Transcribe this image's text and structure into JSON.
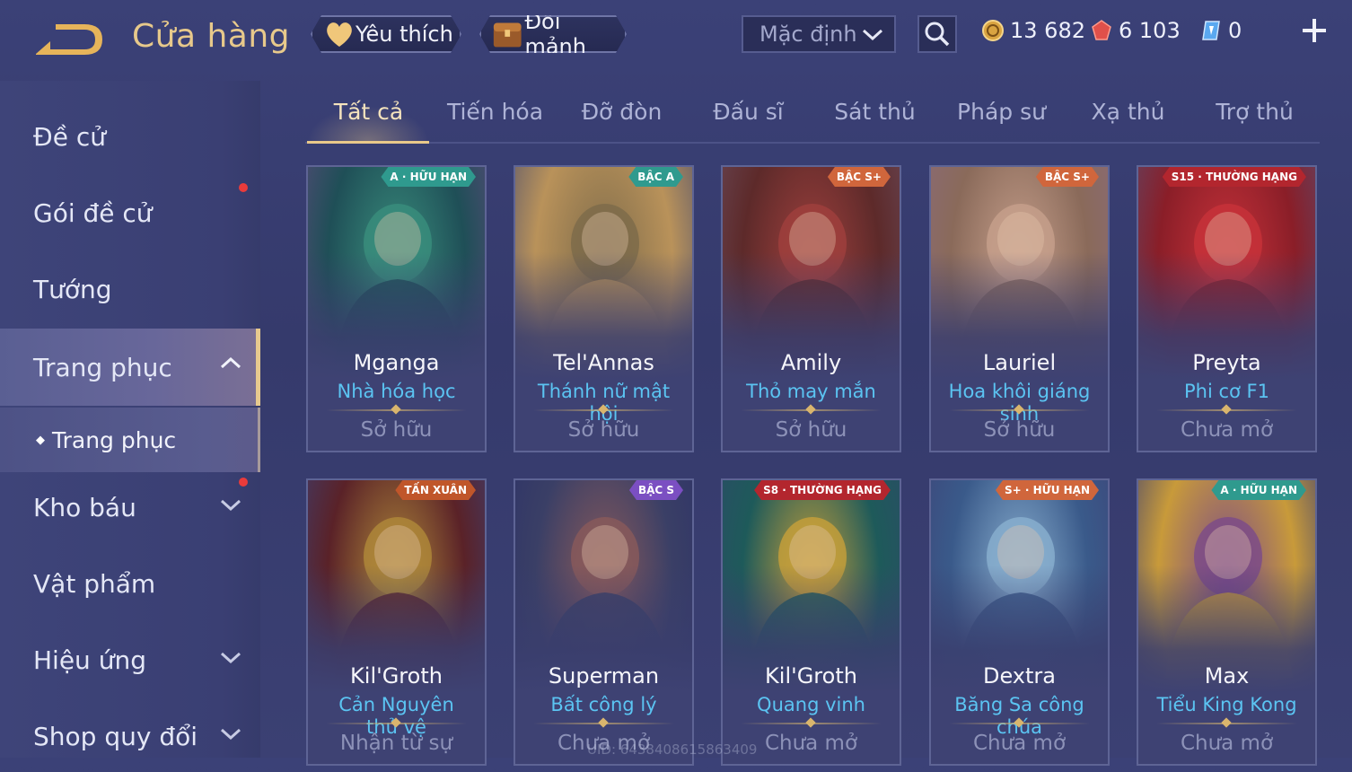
{
  "header": {
    "title": "Cửa hàng",
    "favorite_label": "Yêu thích",
    "exchange_label": "Đổi mảnh",
    "sort_value": "Mặc định",
    "currencies": [
      {
        "name": "gold-coin",
        "value": "13 682",
        "color": "#d9a441"
      },
      {
        "name": "ruby",
        "value": "6 103",
        "color": "#e0504a"
      },
      {
        "name": "voucher",
        "value": "0",
        "color": "#5aa8f0"
      }
    ]
  },
  "sidebar": {
    "items": [
      {
        "label": "Đề cử"
      },
      {
        "label": "Gói đề cử",
        "notification": true
      },
      {
        "label": "Tướng"
      },
      {
        "label": "Trang phục",
        "active": true,
        "expanded": true
      },
      {
        "label": "Kho báu",
        "notification": true
      },
      {
        "label": "Vật phẩm"
      },
      {
        "label": "Hiệu ứng"
      },
      {
        "label": "Shop quy đổi"
      }
    ],
    "sub_item": "Trang phục"
  },
  "tabs": [
    "Tất cả",
    "Tiến hóa",
    "Đỡ đòn",
    "Đấu sĩ",
    "Sát thủ",
    "Pháp sư",
    "Xạ thủ",
    "Trợ thủ"
  ],
  "selected_tab": 0,
  "cards": [
    {
      "hero": "Mganga",
      "skin": "Nhà hóa học",
      "status": "Sở hữu",
      "badge": "A · HỮU HẠN",
      "badge_color": "#2f9a8e",
      "art": [
        "#1f4f57",
        "#3a8f7d",
        "#5d4a7c"
      ]
    },
    {
      "hero": "Tel'Annas",
      "skin": "Thánh nữ mật hội",
      "status": "Sở hữu",
      "badge": "BẬC A",
      "badge_color": "#2f9a8e",
      "art": [
        "#b9925a",
        "#7c6a4a",
        "#4d4f6e"
      ]
    },
    {
      "hero": "Amily",
      "skin": "Thỏ may mắn",
      "status": "Sở hữu",
      "badge": "BẬC S+",
      "badge_color": "#d0663c",
      "art": [
        "#5d2a2a",
        "#a0403d",
        "#6a4a5a"
      ]
    },
    {
      "hero": "Lauriel",
      "skin": "Hoa khôi giáng sinh",
      "status": "Sở hữu",
      "badge": "BẬC S+",
      "badge_color": "#d0663c",
      "art": [
        "#8a6a5a",
        "#c7a08c",
        "#8a6a7c"
      ]
    },
    {
      "hero": "Preyta",
      "skin": "Phi cơ F1",
      "status": "Chưa mở",
      "badge": "S15 · THƯỜNG HẠNG",
      "badge_color": "#b3262e",
      "art": [
        "#8a1e28",
        "#c8323a",
        "#5a4a6c"
      ]
    },
    {
      "hero": "Kil'Groth",
      "skin": "Cản Nguyên thủ vệ",
      "status": "Nhận từ sự",
      "badge": "TẤN XUÂN",
      "badge_color": "#c0562a",
      "art": [
        "#5a2228",
        "#b08a3a",
        "#3d3f72"
      ]
    },
    {
      "hero": "Superman",
      "skin": "Bất công lý",
      "status": "Chưa mở",
      "badge": "BẬC S",
      "badge_color": "#7b4fc2",
      "art": [
        "#3a3f66",
        "#8a5a5a",
        "#2d3268"
      ]
    },
    {
      "hero": "Kil'Groth",
      "skin": "Quang vinh",
      "status": "Chưa mở",
      "badge": "S8 · THƯỜNG HẠNG",
      "badge_color": "#b3262e",
      "art": [
        "#1e5a5a",
        "#c8a03a",
        "#2d4a68"
      ]
    },
    {
      "hero": "Dextra",
      "skin": "Băng Sa công chúa",
      "status": "Chưa mở",
      "badge": "S+ · HỮU HẠN",
      "badge_color": "#d0663c",
      "art": [
        "#3a5a8a",
        "#8ab0d0",
        "#3d4478"
      ]
    },
    {
      "hero": "Max",
      "skin": "Tiểu King Kong",
      "status": "Chưa mở",
      "badge": "A · HỮU HẠN",
      "badge_color": "#2f9a8e",
      "art": [
        "#c89a3a",
        "#7a4a8a",
        "#3d4072"
      ]
    }
  ],
  "uid_watermark": "UID: 6438408615863409"
}
